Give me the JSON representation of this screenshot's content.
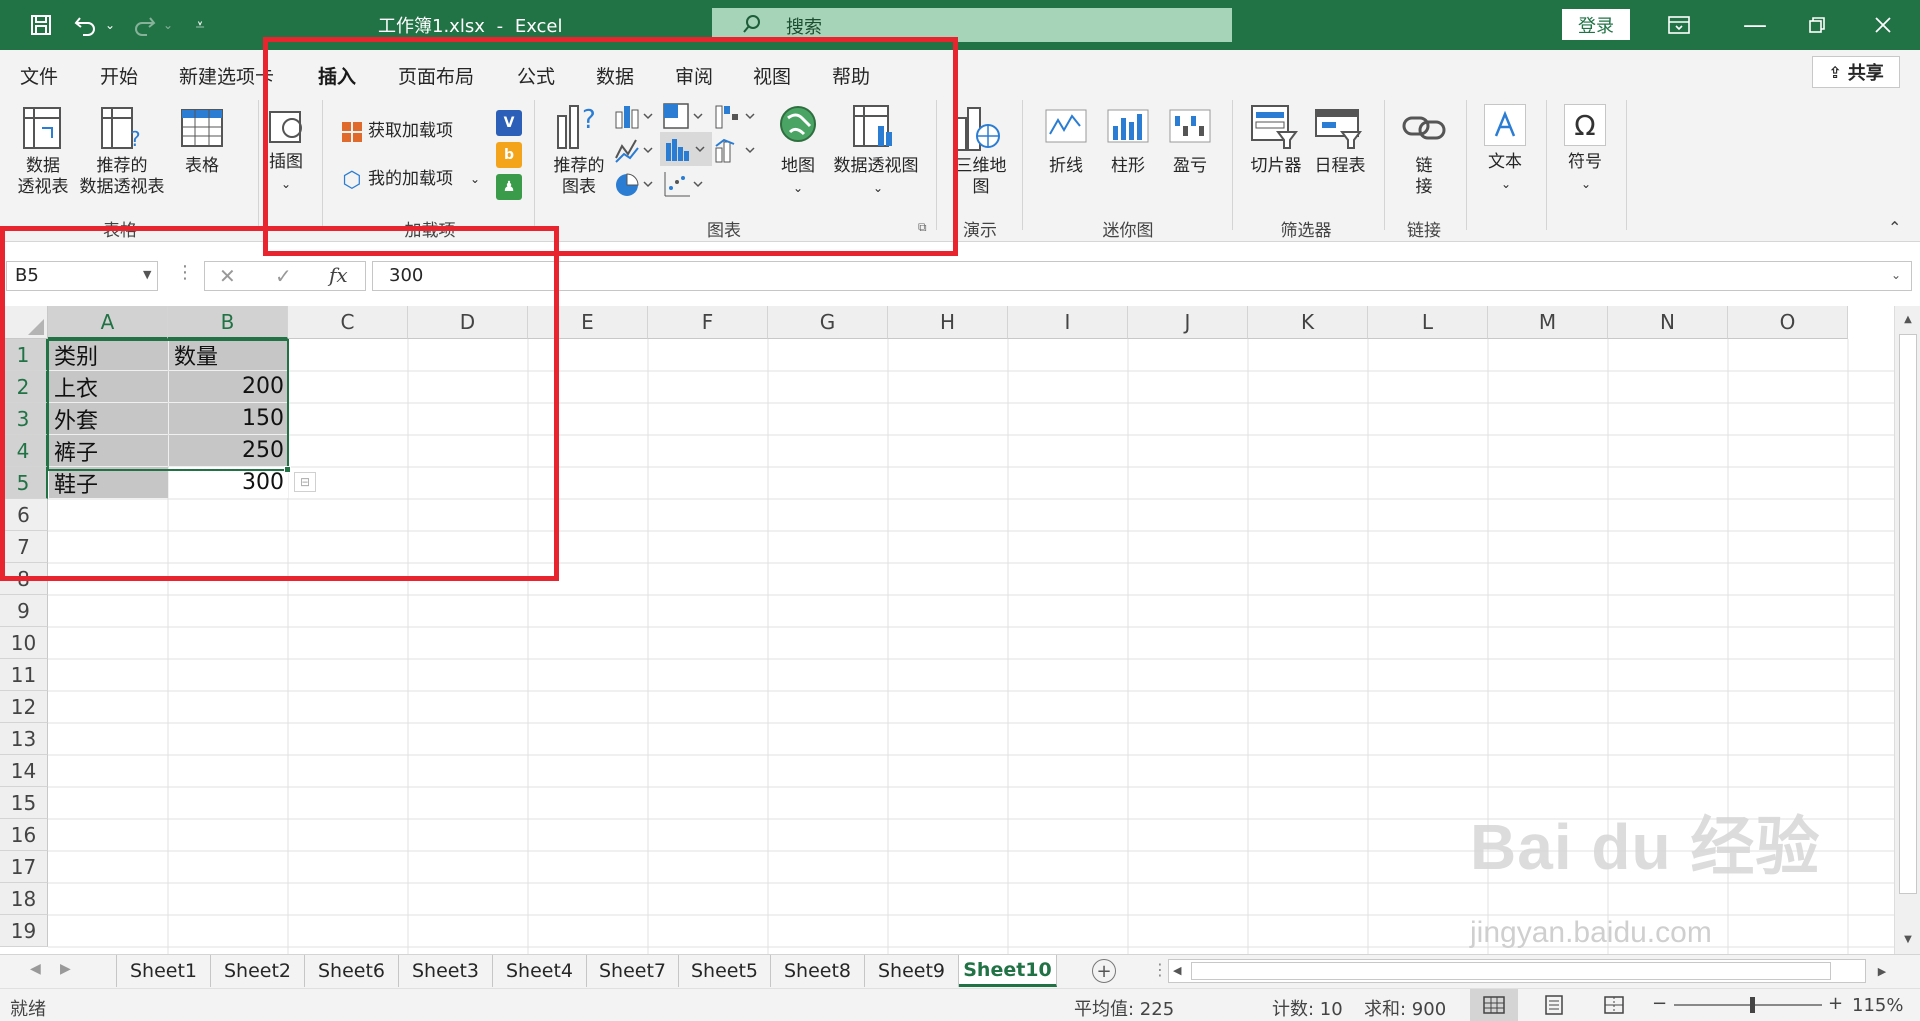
{
  "titlebar": {
    "file_name": "工作簿1.xlsx",
    "separator": "-",
    "app_name": "Excel",
    "search_placeholder": "搜索",
    "login_label": "登录",
    "colors": {
      "bg": "#217346",
      "search_bg": "#a6d4b9"
    }
  },
  "menu": {
    "items": [
      "文件",
      "开始",
      "新建选项卡",
      "插入",
      "页面布局",
      "公式",
      "数据",
      "审阅",
      "视图",
      "帮助"
    ],
    "active": "插入",
    "share_label": "共享"
  },
  "ribbon": {
    "table_group": {
      "pivot_table": [
        "数据",
        "透视表"
      ],
      "recommended_pivot": [
        "推荐的",
        "数据透视表"
      ],
      "table": "表格",
      "label": "表格"
    },
    "illustrations": {
      "label": "插图"
    },
    "addins": {
      "get_addins": "获取加载项",
      "my_addins": "我的加载项",
      "label": "加载项"
    },
    "charts": {
      "recommended": [
        "推荐的",
        "图表"
      ],
      "maps": "地图",
      "pivot_chart": "数据透视图",
      "label": "图表"
    },
    "tours": {
      "map3d": [
        "三维地",
        "图"
      ],
      "label": "演示"
    },
    "sparklines": {
      "line": "折线",
      "column": "柱形",
      "winloss": "盈亏",
      "label": "迷你图"
    },
    "filters": {
      "slicer": "切片器",
      "timeline": "日程表",
      "label": "筛选器"
    },
    "links": {
      "link": [
        "链",
        "接"
      ],
      "label": "链接"
    },
    "text": {
      "label": "文本"
    },
    "symbols": {
      "label": "符号"
    }
  },
  "formula_bar": {
    "name_box": "B5",
    "fx": "fx",
    "value": "300"
  },
  "sheet": {
    "columns": [
      "A",
      "B",
      "C",
      "D",
      "E",
      "F",
      "G",
      "H",
      "I",
      "J",
      "K",
      "L",
      "M",
      "N",
      "O"
    ],
    "rows": [
      "1",
      "2",
      "3",
      "4",
      "5",
      "6",
      "7",
      "8",
      "9",
      "10",
      "11",
      "12",
      "13",
      "14",
      "15",
      "16",
      "17",
      "18",
      "19"
    ],
    "data": [
      [
        "类别",
        "数量"
      ],
      [
        "上衣",
        "200"
      ],
      [
        "外套",
        "150"
      ],
      [
        "裤子",
        "250"
      ],
      [
        "鞋子",
        "300"
      ]
    ]
  },
  "tabs": {
    "items": [
      "Sheet1",
      "Sheet2",
      "Sheet6",
      "Sheet3",
      "Sheet4",
      "Sheet7",
      "Sheet5",
      "Sheet8",
      "Sheet9",
      "Sheet10"
    ],
    "active": "Sheet10"
  },
  "status": {
    "ready": "就绪",
    "average": "平均值: 225",
    "count": "计数: 10",
    "sum": "求和: 900",
    "zoom": "115%"
  },
  "watermark": {
    "brand": "Bai du 经验",
    "url": "jingyan.baidu.com"
  },
  "colors": {
    "accent": "#217346",
    "highlight": "#e8242f",
    "selection": "#c6c6c6"
  }
}
